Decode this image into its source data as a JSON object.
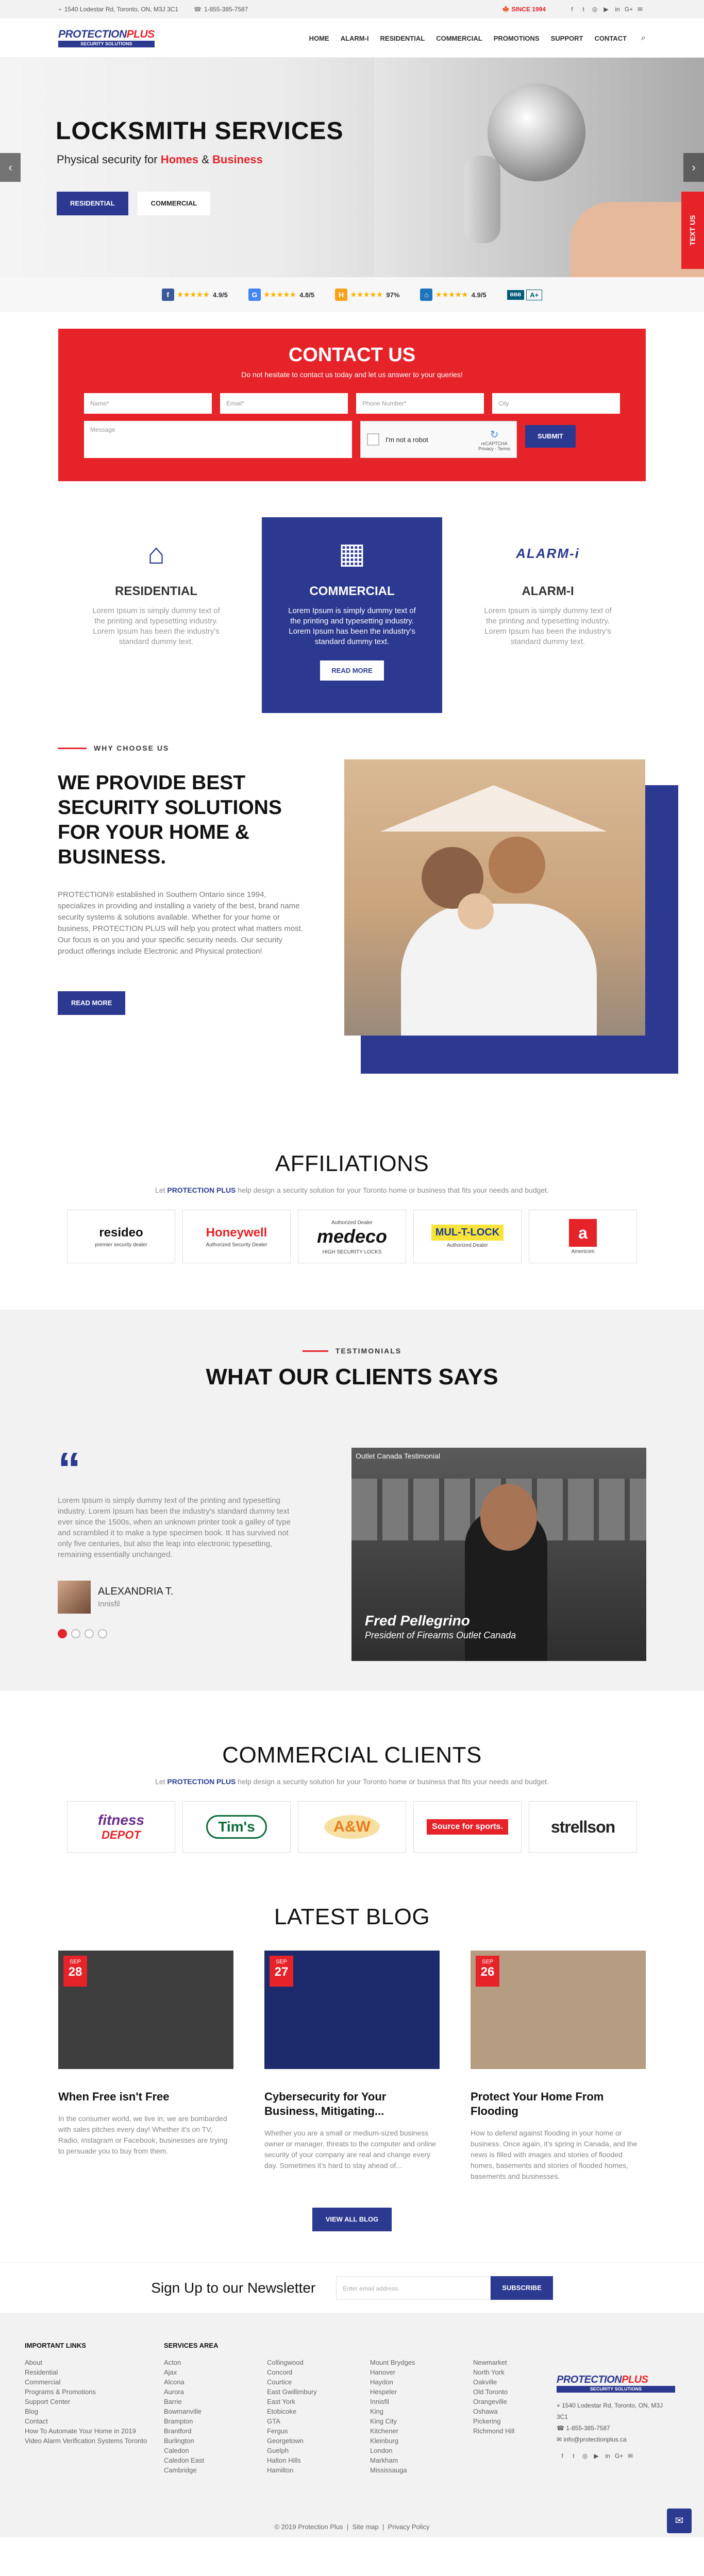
{
  "topbar": {
    "address": "1540 Lodestar Rd, Toronto, ON, M3J 3C1",
    "phone": "1-855-385-7587",
    "since": "SINCE 1994"
  },
  "logo": {
    "brand_a": "PROTECTION",
    "brand_b": "PLUS",
    "tagline": "SECURITY SOLUTIONS"
  },
  "nav": [
    "HOME",
    "ALARM-I",
    "RESIDENTIAL",
    "COMMERCIAL",
    "PROMOTIONS",
    "SUPPORT",
    "CONTACT"
  ],
  "hero": {
    "title": "LOCKSMITH SERVICES",
    "sub_a": "Physical security for ",
    "sub_b": "Homes",
    "sub_c": " & ",
    "sub_d": "Business",
    "btn_res": "RESIDENTIAL",
    "btn_com": "COMMERCIAL",
    "text_us": "TEXT US"
  },
  "ratings": [
    {
      "icon": "facebook-icon",
      "glyph": "f",
      "color": "#3b5998",
      "stars": "★★★★★",
      "score": "4.9/5"
    },
    {
      "icon": "google-icon",
      "glyph": "G",
      "color": "#4285f4",
      "stars": "★★★★★",
      "score": "4.8/5"
    },
    {
      "icon": "homestars-icon",
      "glyph": "H",
      "color": "#f7a21b",
      "stars": "★★★★★",
      "score": "97%"
    },
    {
      "icon": "house-icon",
      "glyph": "⌂",
      "color": "#1e73be",
      "stars": "★★★★★",
      "score": "4.9/5"
    }
  ],
  "bbb": {
    "label": "BBB",
    "grade": "A+"
  },
  "contact": {
    "title": "CONTACT US",
    "sub": "Do not hesitate to contact us today and let us answer to your queries!",
    "name": "Name*",
    "email": "Email*",
    "phone": "Phone Number*",
    "city": "City",
    "message": "Message",
    "captcha": "I'm not a robot",
    "captcha_brand": "reCAPTCHA",
    "captcha_links": "Privacy - Terms",
    "submit": "SUBMIT"
  },
  "services": [
    {
      "title": "RESIDENTIAL",
      "text": "Lorem Ipsum is simply dummy text of the printing and typesetting industry. Lorem Ipsum has been the industry's standard dummy text."
    },
    {
      "title": "COMMERCIAL",
      "text": "Lorem Ipsum is simply dummy text of the printing and typesetting industry. Lorem Ipsum has been the industry's standard dummy text.",
      "btn": "READ MORE"
    },
    {
      "title": "ALARM-I",
      "logo": "ALARM-i",
      "text": "Lorem Ipsum is simply dummy text of the printing and typesetting industry. Lorem Ipsum has been the industry's standard dummy text."
    }
  ],
  "why": {
    "kicker": "WHY CHOOSE US",
    "title": "WE PROVIDE BEST SECURITY SOLUTIONS FOR YOUR HOME & BUSINESS.",
    "text": "PROTECTION® established in Southern Ontario since 1994, specializes in providing and installing a variety of the best, brand name security systems & solutions available. Whether for your home or business, PROTECTION PLUS will help you protect what matters most. Our focus is on you and your specific security needs. Our security product offerings include Electronic and Physical protection!",
    "btn": "READ MORE"
  },
  "affiliations": {
    "title": "AFFILIATIONS",
    "sub_a": "Let ",
    "sub_b": "PROTECTION PLUS",
    "sub_c": " help design a security solution for your Toronto home or business that fits your needs and budget.",
    "logos": [
      {
        "name": "resideo",
        "small": "premier security dealer"
      },
      {
        "name": "Honeywell",
        "small": "Authorized Security Dealer"
      },
      {
        "name": "medeco",
        "small": "HIGH SECURITY LOCKS",
        "top": "Authorized Dealer"
      },
      {
        "name": "MUL-T-LOCK",
        "small": "Authorized Dealer"
      },
      {
        "name": "a",
        "small": "Americom"
      }
    ]
  },
  "testimonials": {
    "kicker": "TESTIMONIALS",
    "title": "WHAT OUR CLIENTS SAYS",
    "quote": "Lorem Ipsum is simply dummy text of the printing and typesetting industry. Lorem Ipsum has been the industry's standard dummy text ever since the 1500s, when an unknown printer took a galley of type and scrambled it to make a type specimen book. It has survived not only five centuries, but also the leap into electronic typesetting, remaining essentially unchanged.",
    "name": "ALEXANDRIA T.",
    "city": "Innisfil",
    "video_title": "Outlet Canada Testimonial",
    "video_name": "Fred Pellegrino",
    "video_role": "President of Firearms Outlet Canada"
  },
  "clients": {
    "title": "COMMERCIAL CLIENTS",
    "logos": [
      {
        "a": "fitness",
        "b": "DEPOT"
      },
      {
        "a": "Tim's"
      },
      {
        "a": "A&W"
      },
      {
        "a": "Source for sports."
      },
      {
        "a": "strellson"
      }
    ]
  },
  "blog": {
    "title": "LATEST BLOG",
    "posts": [
      {
        "mon": "SEP",
        "day": "28",
        "title": "When Free isn't Free",
        "text": "In the consumer world, we live in; we are bombarded with sales pitches every day! Whether it's on TV, Radio, Instagram or Facebook, businesses are trying to persuade you to buy from them.",
        "img": "#3e3e3e"
      },
      {
        "mon": "SEP",
        "day": "27",
        "title": "Cybersecurity for Your Business, Mitigating...",
        "text": "Whether you are a small or medium-sized business owner or manager, threats to the computer and online security of your company are real and change every day. Sometimes it's hard to stay ahead of...",
        "img": "#1d2a6b"
      },
      {
        "mon": "SEP",
        "day": "26",
        "title": "Protect Your Home From Flooding",
        "text": "How to defend against flooding in your home or business. Once again, it's spring in Canada, and the news is filled with images and stories of flooded homes, basements and stories of flooded homes, basements and businesses.",
        "img": "#b69c80"
      }
    ],
    "view_all": "VIEW ALL BLOG"
  },
  "newsletter": {
    "title": "Sign Up to our Newsletter",
    "placeholder": "Enter email address",
    "btn": "SUBSCRIBE"
  },
  "footer": {
    "links_title": "IMPORTANT LINKS",
    "links": [
      "About",
      "Residential",
      "Commercial",
      "Programs & Promotions",
      "Support Center",
      "Blog",
      "Contact",
      "How To Automate Your Home in 2019",
      "Video Alarm Verification Systems Toronto"
    ],
    "areas_title": "SERVICES AREA",
    "areas1": [
      "Acton",
      "Ajax",
      "Alcona",
      "Aurora",
      "Barrie",
      "Bowmanville",
      "Brampton",
      "Brantford",
      "Burlington",
      "Caledon",
      "Caledon East",
      "Cambridge"
    ],
    "areas2": [
      "Collingwood",
      "Concord",
      "Courtice",
      "East Gwillimbury",
      "East York",
      "Etobicoke",
      "GTA",
      "Fergus",
      "Georgetown",
      "Guelph",
      "Halton Hills",
      "Hamilton"
    ],
    "areas3": [
      "Mount Brydges",
      "Hanover",
      "Haydon",
      "Hespeler",
      "Innisfil",
      "King",
      "King City",
      "Kitchener",
      "Kleinburg",
      "London",
      "Markham",
      "Mississauga"
    ],
    "areas4": [
      "Newmarket",
      "North York",
      "Oakville",
      "Old Toronto",
      "Orangeville",
      "Oshawa",
      "Pickering",
      "Richmond Hill"
    ],
    "address": "1540 Lodestar Rd, Toronto, ON, M3J 3C1",
    "phone": "1-855-385-7587",
    "email": "info@protectionplus.ca",
    "copy": "© 2019 Protection Plus",
    "sitemap": "Site map",
    "privacy": "Privacy Policy"
  }
}
